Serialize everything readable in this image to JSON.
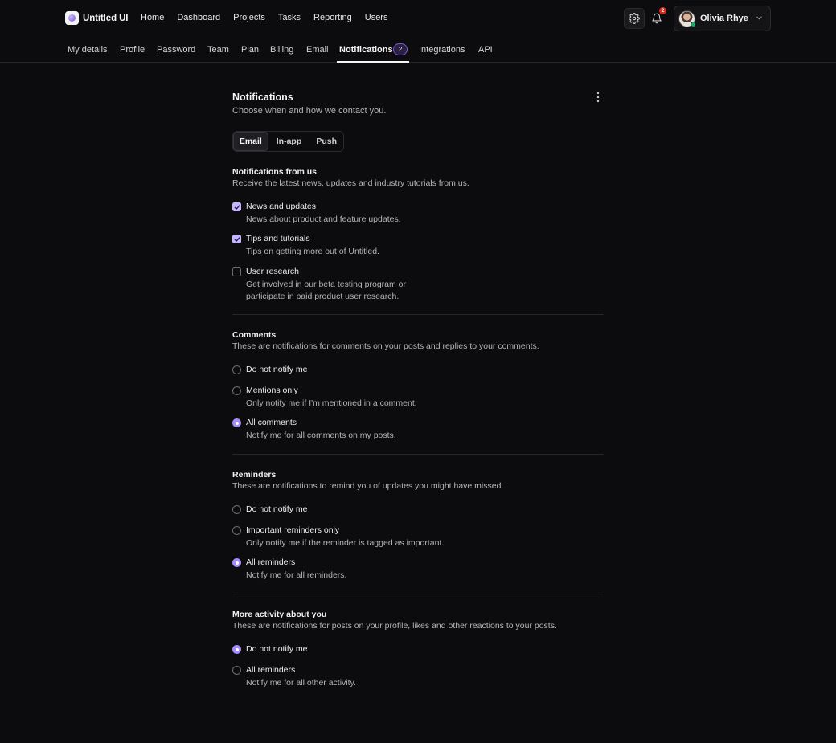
{
  "app": {
    "name": "Untitled UI"
  },
  "nav": [
    "Home",
    "Dashboard",
    "Projects",
    "Tasks",
    "Reporting",
    "Users"
  ],
  "notifications_badge": "2",
  "user": {
    "name": "Olivia Rhye"
  },
  "tabs": [
    {
      "label": "My details"
    },
    {
      "label": "Profile"
    },
    {
      "label": "Password"
    },
    {
      "label": "Team"
    },
    {
      "label": "Plan"
    },
    {
      "label": "Billing"
    },
    {
      "label": "Email"
    },
    {
      "label": "Notifications",
      "active": true,
      "count": "2"
    },
    {
      "label": "Integrations"
    },
    {
      "label": "API"
    }
  ],
  "page": {
    "title": "Notifications",
    "subtitle": "Choose when and how we contact you."
  },
  "channels": [
    {
      "label": "Email",
      "active": true
    },
    {
      "label": "In-app"
    },
    {
      "label": "Push"
    }
  ],
  "sections": {
    "from_us": {
      "title": "Notifications from us",
      "desc": "Receive the latest news, updates and industry tutorials from us.",
      "options": [
        {
          "label": "News and updates",
          "hint": "News about product and feature updates.",
          "checked": true
        },
        {
          "label": "Tips and tutorials",
          "hint": "Tips on getting more out of Untitled.",
          "checked": true
        },
        {
          "label": "User research",
          "hint": "Get involved in our beta testing program or participate in paid product user research.",
          "checked": false
        }
      ]
    },
    "comments": {
      "title": "Comments",
      "desc": "These are notifications for comments on your posts and replies to your comments.",
      "options": [
        {
          "label": "Do not notify me",
          "hint": "",
          "selected": false
        },
        {
          "label": "Mentions only",
          "hint": "Only notify me if I'm mentioned in a comment.",
          "selected": false
        },
        {
          "label": "All comments",
          "hint": "Notify me for all comments on my posts.",
          "selected": true
        }
      ]
    },
    "reminders": {
      "title": "Reminders",
      "desc": "These are notifications to remind you of updates you might have missed.",
      "options": [
        {
          "label": "Do not notify me",
          "hint": "",
          "selected": false
        },
        {
          "label": "Important reminders only",
          "hint": "Only notify me if the reminder is tagged as important.",
          "selected": false
        },
        {
          "label": "All reminders",
          "hint": "Notify me for all reminders.",
          "selected": true
        }
      ]
    },
    "activity": {
      "title": "More activity about you",
      "desc": "These are notifications for posts on your profile, likes and other reactions to your posts.",
      "options": [
        {
          "label": "Do not notify me",
          "hint": "",
          "selected": true
        },
        {
          "label": "All reminders",
          "hint": "Notify me for all other activity.",
          "selected": false
        }
      ]
    }
  },
  "colors": {
    "accent": "#a48afb",
    "checkbox_on": "#c5b5ff",
    "background": "#0c0c0e",
    "badge": "#d92d20"
  },
  "icons": [
    "logo-icon",
    "settings-icon",
    "bell-icon",
    "chevron-down-icon",
    "more-vertical-icon",
    "check-icon"
  ]
}
